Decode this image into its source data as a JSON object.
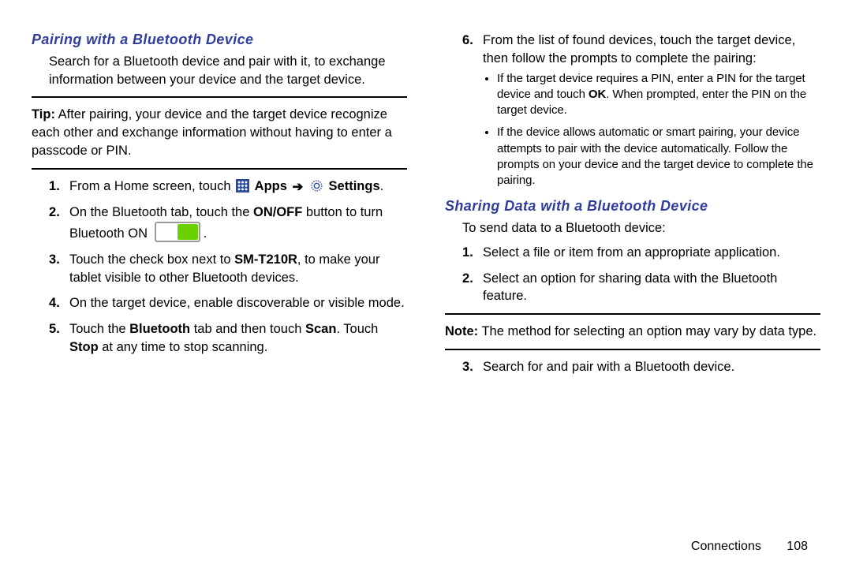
{
  "left": {
    "heading1": "Pairing with a Bluetooth Device",
    "intro": "Search for a Bluetooth device and pair with it, to exchange information between your device and the target device.",
    "tip_label": "Tip:",
    "tip_text": " After pairing, your device and the target device recognize each other and exchange information without having to enter a passcode or PIN.",
    "step1_a": "From a Home screen, touch ",
    "step1_apps": "Apps",
    "step1_settings": "Settings",
    "step1_end": ".",
    "step2_a": "On the Bluetooth tab, touch the ",
    "step2_onoff": "ON/OFF",
    "step2_b": " button to turn Bluetooth ON ",
    "step2_end": ".",
    "step3_a": "Touch the check box next to ",
    "step3_model": "SM-T210R",
    "step3_b": ", to make your tablet visible to other Bluetooth devices.",
    "step4": "On the target device, enable discoverable or visible mode.",
    "step5_a": "Touch the ",
    "step5_bt": "Bluetooth",
    "step5_b": " tab and then touch ",
    "step5_scan": "Scan",
    "step5_c": ". Touch ",
    "step5_stop": "Stop",
    "step5_d": " at any time to stop scanning."
  },
  "right": {
    "step6": "From the list of found devices, touch the target device, then follow the prompts to complete the pairing:",
    "bul1_a": "If the target device requires a PIN, enter a PIN for the target device and touch ",
    "bul1_ok": "OK",
    "bul1_b": ". When prompted, enter the PIN on the target device.",
    "bul2": "If the device allows automatic or smart pairing, your device attempts to pair with the device automatically. Follow the prompts on your device and the target device to complete the pairing.",
    "heading2": "Sharing Data with a Bluetooth Device",
    "intro2": "To send data to a Bluetooth device:",
    "s_step1": "Select a file or item from an appropriate application.",
    "s_step2": "Select an option for sharing data with the Bluetooth feature.",
    "note_label": "Note:",
    "note_text": " The method for selecting an option may vary by data type.",
    "s_step3": "Search for and pair with a Bluetooth device."
  },
  "footer": {
    "section": "Connections",
    "page": "108"
  }
}
